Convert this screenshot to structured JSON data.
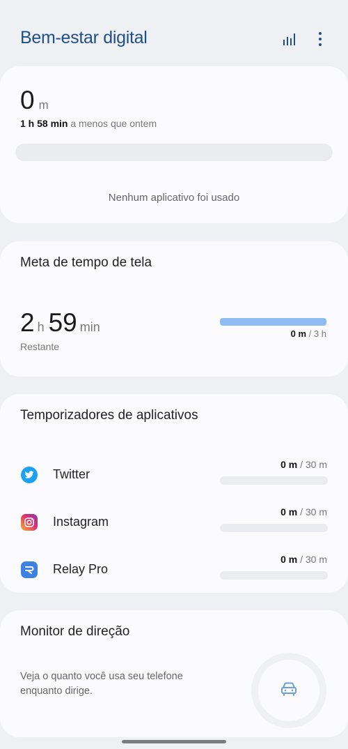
{
  "header": {
    "title": "Bem-estar digital",
    "icons": [
      "bar-chart-icon",
      "more-vertical-icon"
    ]
  },
  "usage": {
    "value": "0",
    "unit": "m",
    "compare_bold": "1 h 58 min",
    "compare_rest": " a menos que ontem",
    "empty_message": "Nenhum aplicativo foi usado"
  },
  "screen_goal": {
    "title": "Meta de tempo de tela",
    "hours": "2",
    "hours_unit": "h",
    "minutes": "59",
    "minutes_unit": "min",
    "remaining_label": "Restante",
    "used": "0 m",
    "goal": " / 3 h",
    "bar_fill_fraction": 1.0,
    "bar_color": "#8cbcf0"
  },
  "app_timers": {
    "title": "Temporizadores de aplicativos",
    "apps": [
      {
        "name": "Twitter",
        "used": "0 m",
        "limit": " / 30 m",
        "icon": "twitter-icon",
        "color": "#1da1f2"
      },
      {
        "name": "Instagram",
        "used": "0 m",
        "limit": " / 30 m",
        "icon": "instagram-icon",
        "color": "#e1306c"
      },
      {
        "name": "Relay Pro",
        "used": "0 m",
        "limit": " / 30 m",
        "icon": "relay-icon",
        "color": "#3d82e0"
      }
    ]
  },
  "driving": {
    "title": "Monitor de direção",
    "description": "Veja o quanto você usa seu telefone enquanto dirige.",
    "icon": "car-icon",
    "icon_color": "#6a9fd8"
  }
}
